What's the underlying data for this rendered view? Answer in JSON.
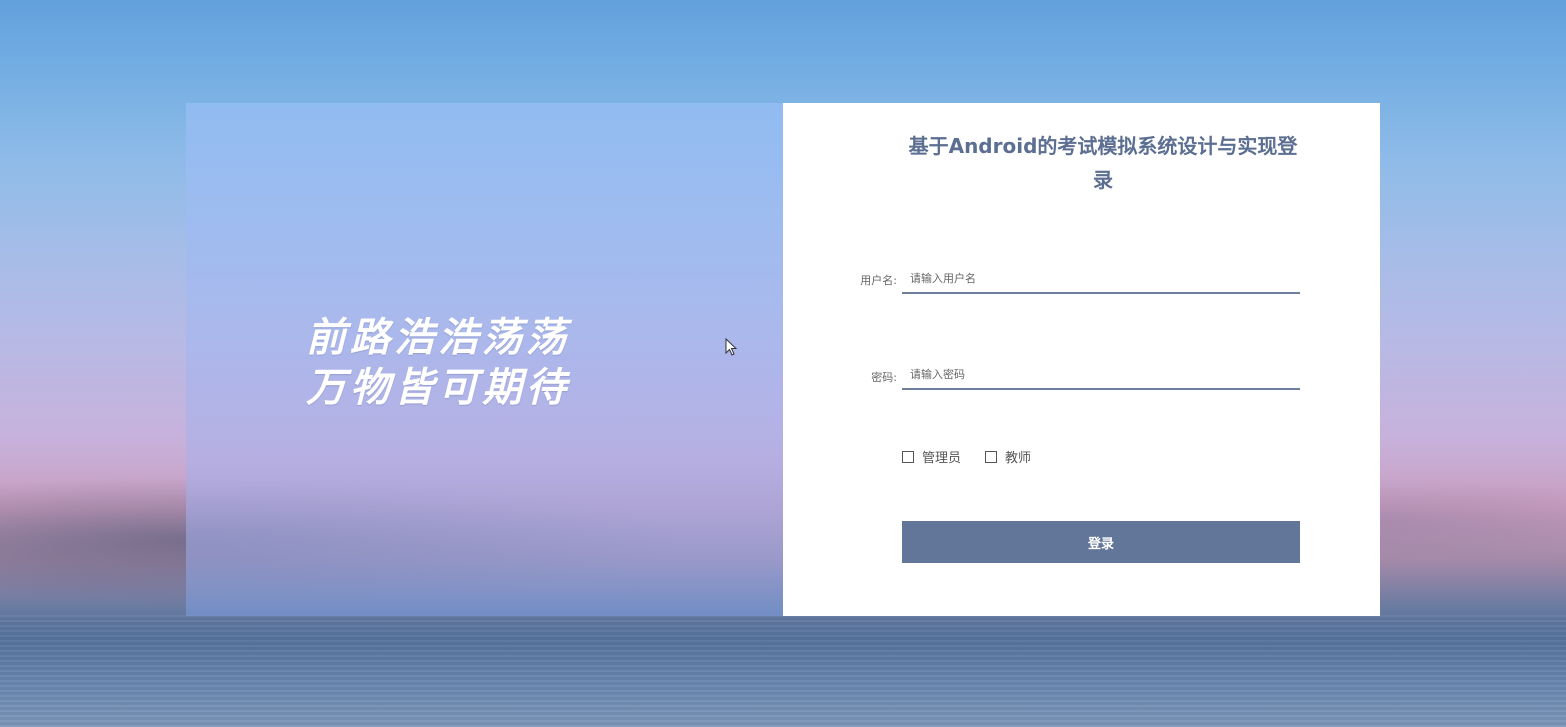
{
  "left_panel": {
    "slogan_line1": "前路浩浩荡荡",
    "slogan_line2": "万物皆可期待"
  },
  "login": {
    "title": "基于Android的考试模拟系统设计与实现登录",
    "username_label": "用户名:",
    "username_placeholder": "请输入用户名",
    "username_value": "",
    "password_label": "密码:",
    "password_placeholder": "请输入密码",
    "password_value": "",
    "roles": [
      {
        "label": "管理员",
        "checked": false
      },
      {
        "label": "教师",
        "checked": false
      }
    ],
    "submit_label": "登录"
  },
  "colors": {
    "title": "#5c6e91",
    "button": "#62769a",
    "underline": "#6e7f9c"
  },
  "icons": {
    "cursor": "mouse-pointer-icon",
    "checkbox": "checkbox-unchecked-icon"
  }
}
